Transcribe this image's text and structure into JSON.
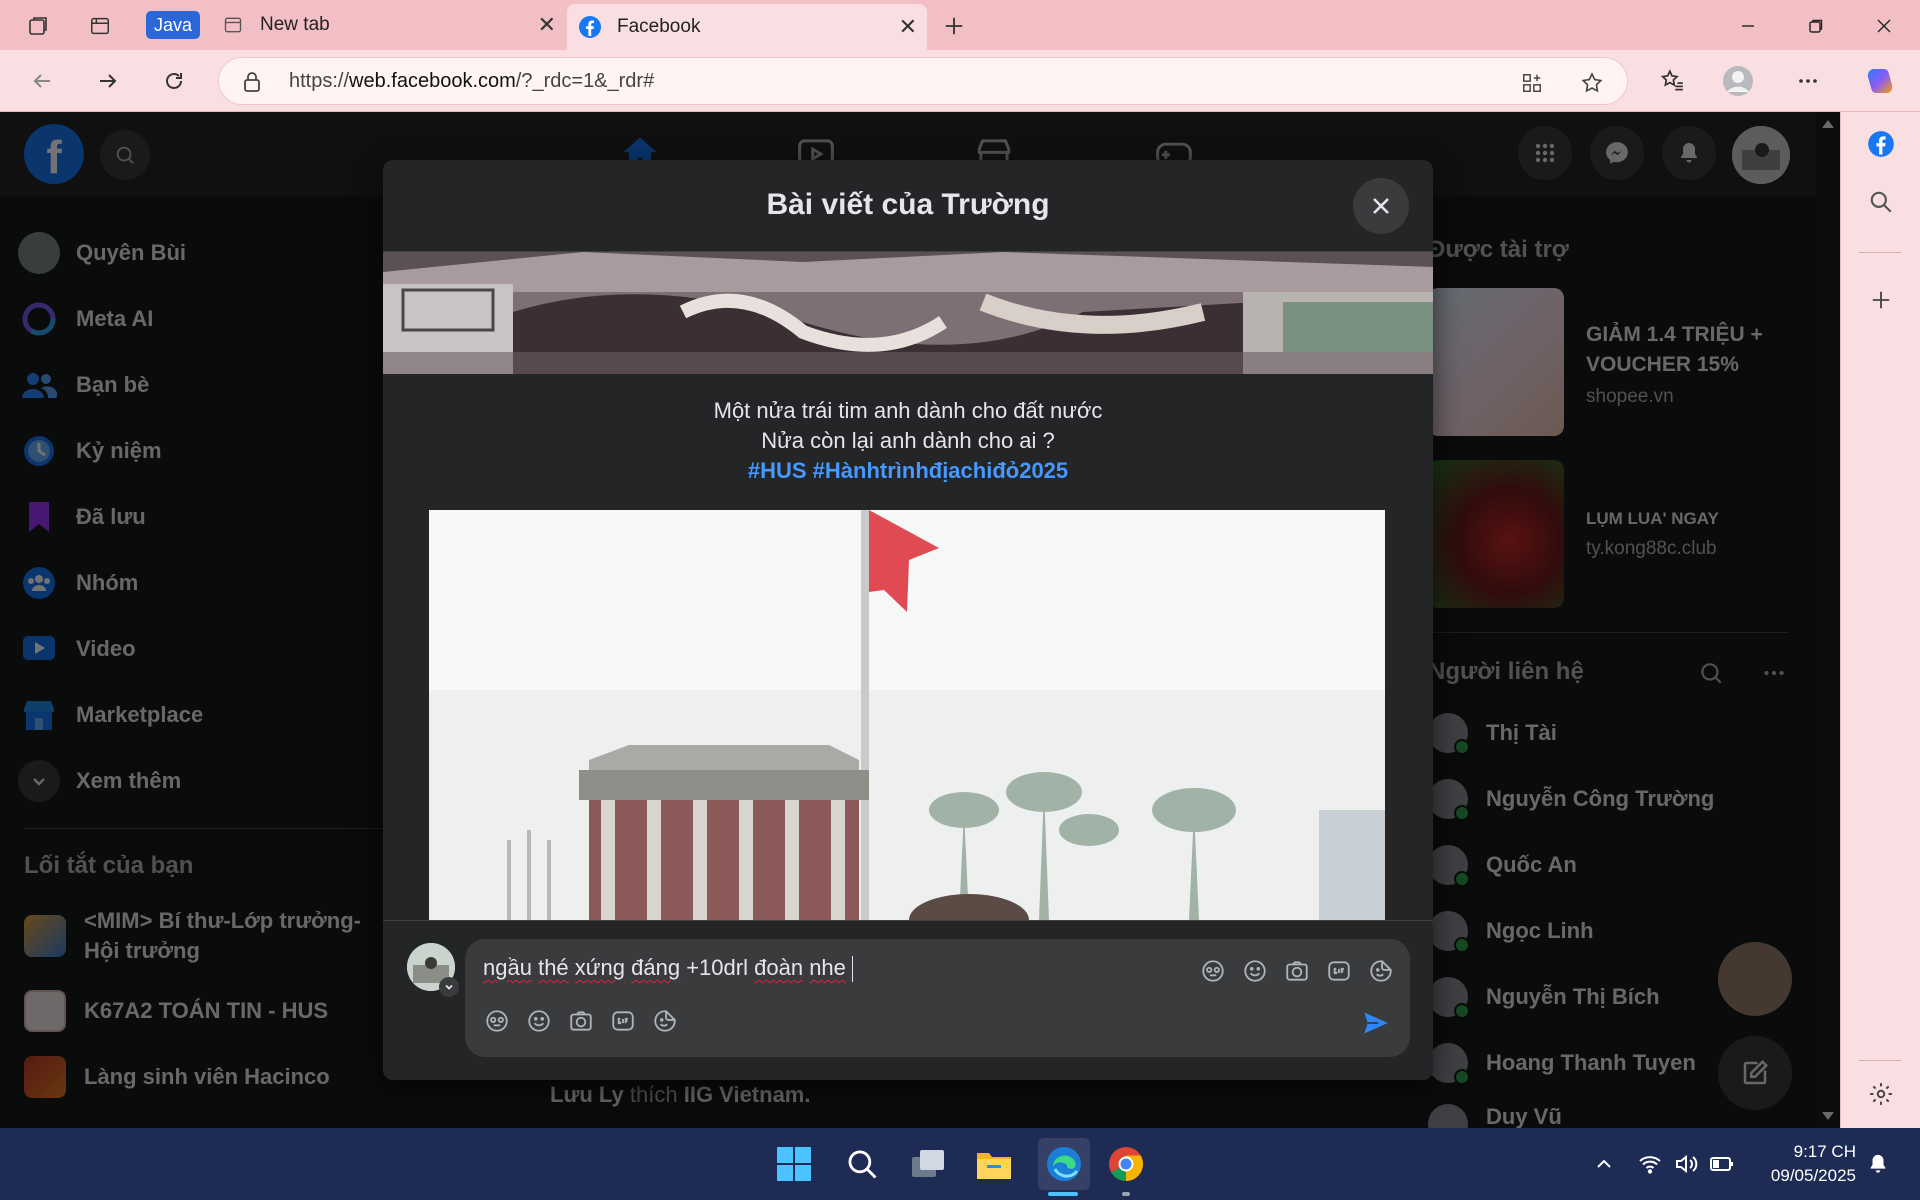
{
  "browser": {
    "tabs": [
      {
        "label": "Java"
      },
      {
        "label": "New tab"
      },
      {
        "label": "Facebook"
      }
    ],
    "url_prefix": "https://",
    "url_domain": "web.facebook.com",
    "url_path": "/?_rdc=1&_rdr#"
  },
  "fb": {
    "left_nav": [
      {
        "label": "Quyên Bùi",
        "icon": "avatar"
      },
      {
        "label": "Meta AI",
        "icon": "meta-ai-icon"
      },
      {
        "label": "Bạn bè",
        "icon": "friends-icon"
      },
      {
        "label": "Kỷ niệm",
        "icon": "memories-icon"
      },
      {
        "label": "Đã lưu",
        "icon": "saved-icon"
      },
      {
        "label": "Nhóm",
        "icon": "groups-icon"
      },
      {
        "label": "Video",
        "icon": "video-icon"
      },
      {
        "label": "Marketplace",
        "icon": "marketplace-icon"
      },
      {
        "label": "Xem thêm",
        "icon": "chevron-down-icon"
      }
    ],
    "shortcuts_title": "Lối tắt của bạn",
    "shortcuts": [
      {
        "label": "<MIM> Bí thư-Lớp trưởng-Hội trưởng"
      },
      {
        "label": "K67A2 TOÁN TIN - HUS"
      },
      {
        "label": "Làng sinh viên Hacinco"
      }
    ],
    "sponsored_title": "Được tài trợ",
    "ads": [
      {
        "title": "GIẢM 1.4 TRIỆU + VOUCHER 15%",
        "domain": "shopee.vn"
      },
      {
        "title": "LỤM LUA' NGAY",
        "domain": "ty.kong88c.club"
      }
    ],
    "contacts_title": "Người liên hệ",
    "contacts": [
      {
        "name": "Thị Tài"
      },
      {
        "name": "Nguyễn Công Trường"
      },
      {
        "name": "Quốc An"
      },
      {
        "name": "Ngọc Linh"
      },
      {
        "name": "Nguyễn Thị Bích"
      },
      {
        "name": "Hoang Thanh Tuyen"
      },
      {
        "name": "Duy Vũ"
      }
    ],
    "feed_activity": {
      "person": "Lưu Ly",
      "verb": "thích",
      "page": "IIG Vietnam."
    }
  },
  "modal": {
    "title": "Bài viết của Trường",
    "post_line1": "Một nửa trái tim anh dành cho đất nước",
    "post_line2": "Nửa còn lại anh dành cho ai ?",
    "hashtags": "#HUS #Hànhtrìnhđịachiđỏ2025",
    "comment_words": [
      "ngầu",
      "thé",
      "xứng",
      "đáng",
      "+10drl",
      "đoàn",
      "nhe"
    ]
  },
  "taskbar": {
    "time": "9:17 CH",
    "date": "09/05/2025"
  },
  "colors": {
    "chrome_pink": "#f2c0c4",
    "fb_blue": "#1877f2",
    "hashtag_blue": "#4599ff",
    "modal_bg": "#242526"
  }
}
